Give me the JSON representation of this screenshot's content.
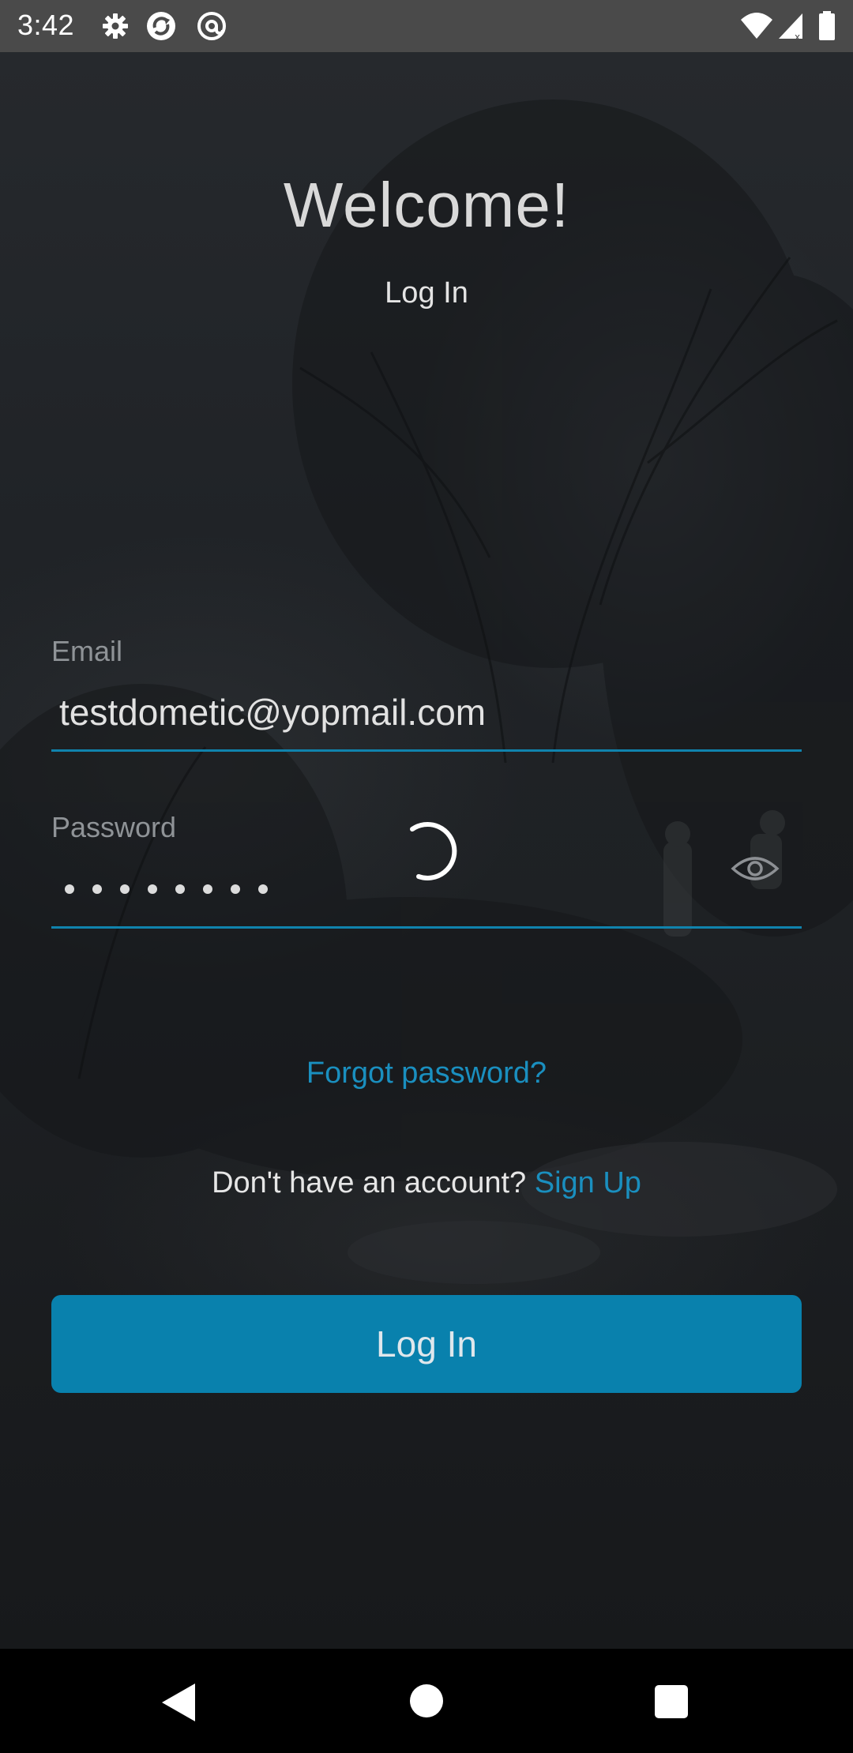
{
  "status_bar": {
    "time": "3:42",
    "icons_left": [
      "gear-icon",
      "app-sync-icon",
      "at-sign-icon"
    ],
    "icons_right": [
      "wifi-icon",
      "signal-icon",
      "battery-icon"
    ]
  },
  "header": {
    "title": "Welcome!",
    "subtitle": "Log In"
  },
  "form": {
    "email_label": "Email",
    "email_value": "testdometic@yopmail.com",
    "password_label": "Password",
    "password_masked_length": 8,
    "password_visibility_icon": "eye-icon",
    "loading": true
  },
  "links": {
    "forgot_password": "Forgot password?",
    "no_account_text": "Don't have an account?",
    "sign_up": "Sign Up"
  },
  "actions": {
    "login_button": "Log In"
  },
  "colors": {
    "accent": "#1083ad",
    "link": "#1a8fbf",
    "button_bg": "#0981ad",
    "status_bar_bg": "#4a4a4a",
    "nav_bar_bg": "#000000"
  },
  "nav_bar": {
    "icons": [
      "back-icon",
      "home-icon",
      "recents-icon"
    ]
  }
}
